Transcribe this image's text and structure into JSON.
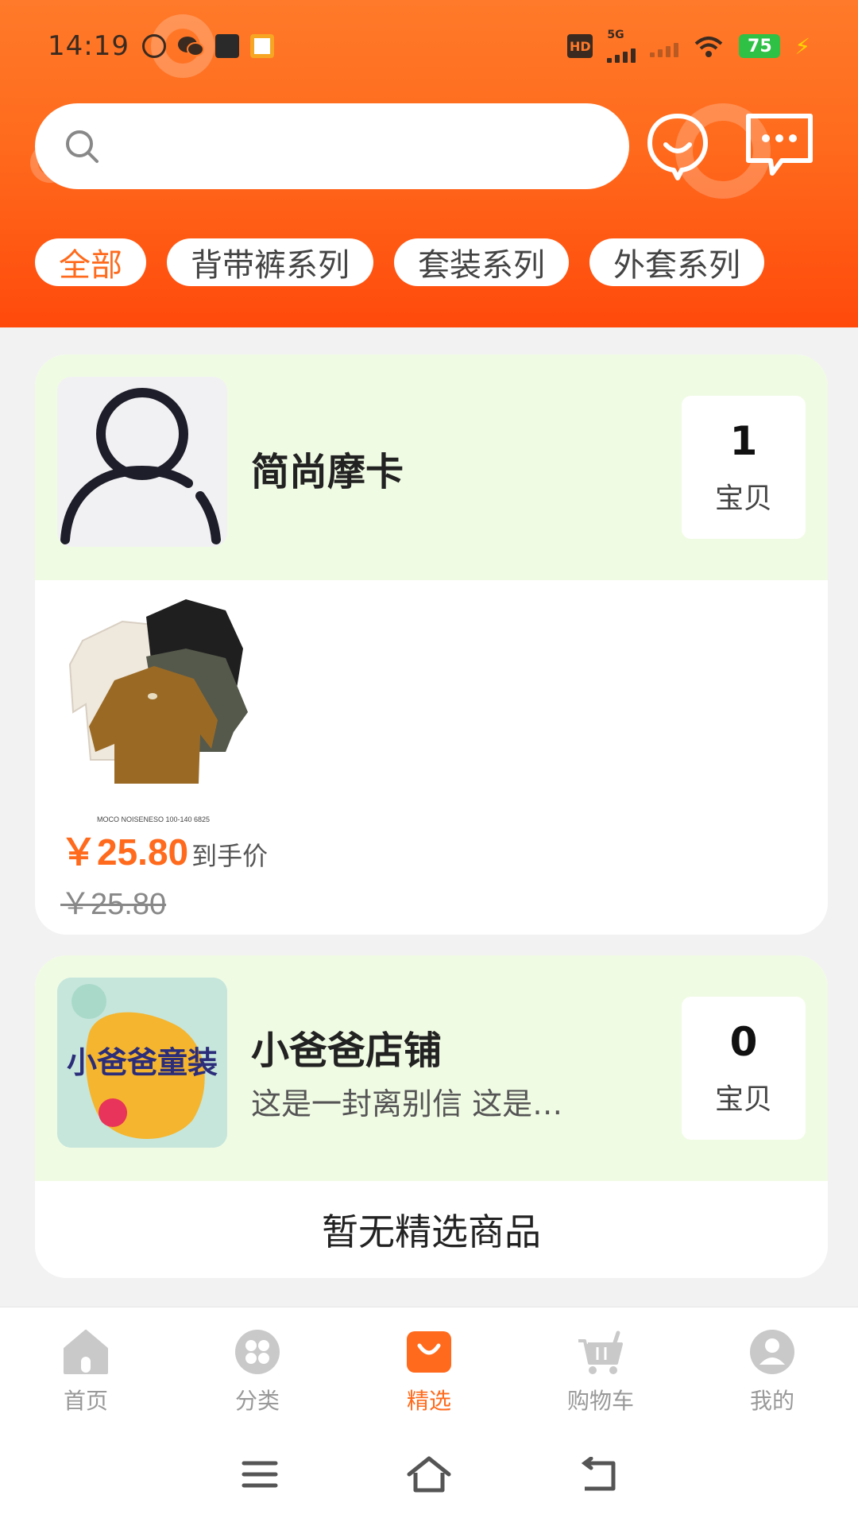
{
  "status_bar": {
    "time": "14:19",
    "battery": "75",
    "hd": "HD",
    "network": "5G"
  },
  "search": {
    "placeholder": ""
  },
  "categories": [
    {
      "label": "全部",
      "active": true
    },
    {
      "label": "背带裤系列",
      "active": false
    },
    {
      "label": "套装系列",
      "active": false
    },
    {
      "label": "外套系列",
      "active": false
    }
  ],
  "stores": [
    {
      "name": "简尚摩卡",
      "count": "1",
      "count_label": "宝贝",
      "product": {
        "price": "￥25.80",
        "price_suffix": "到手价",
        "original_price": "￥25.80",
        "image_caption": "MOCO NOISENESO 100-140 6825"
      }
    },
    {
      "name": "小爸爸店铺",
      "description": "这是一封离别信 这是…",
      "count": "0",
      "count_label": "宝贝",
      "logo_text": "小爸爸童装",
      "empty_text": "暂无精选商品"
    }
  ],
  "bottom_nav": [
    {
      "label": "首页",
      "icon": "home-icon",
      "active": false
    },
    {
      "label": "分类",
      "icon": "category-icon",
      "active": false
    },
    {
      "label": "精选",
      "icon": "featured-bag-icon",
      "active": true
    },
    {
      "label": "购物车",
      "icon": "cart-icon",
      "active": false
    },
    {
      "label": "我的",
      "icon": "profile-icon",
      "active": false
    }
  ],
  "colors": {
    "accent": "#ff6a1c",
    "header_top": "#ff7a2a",
    "header_bottom": "#ff4a0c",
    "store_head_bg": "#f0fbe4",
    "inactive_nav": "#999999"
  }
}
